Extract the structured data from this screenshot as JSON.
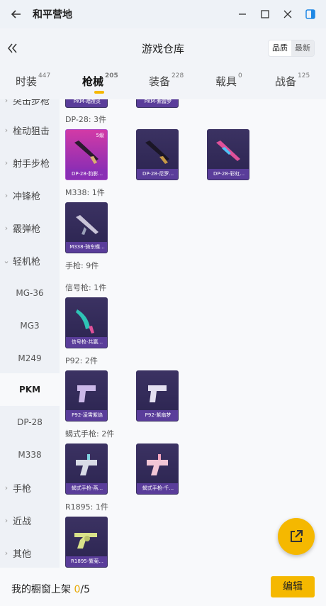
{
  "window": {
    "title": "和平营地"
  },
  "header": {
    "title": "游戏仓库",
    "sort_options": [
      "品质",
      "最新"
    ]
  },
  "tabs": [
    {
      "label": "时装",
      "count": "447"
    },
    {
      "label": "枪械",
      "count": "205"
    },
    {
      "label": "装备",
      "count": "228"
    },
    {
      "label": "载具",
      "count": "0"
    },
    {
      "label": "战备",
      "count": "125"
    }
  ],
  "sidebar": {
    "items": [
      {
        "label": "突击步枪",
        "kind": "category"
      },
      {
        "label": "栓动狙击",
        "kind": "category"
      },
      {
        "label": "射手步枪",
        "kind": "category"
      },
      {
        "label": "冲锋枪",
        "kind": "category"
      },
      {
        "label": "霰弹枪",
        "kind": "category"
      },
      {
        "label": "轻机枪",
        "kind": "category-open"
      },
      {
        "label": "MG-36",
        "kind": "sub"
      },
      {
        "label": "MG3",
        "kind": "sub"
      },
      {
        "label": "M249",
        "kind": "sub"
      },
      {
        "label": "PKM",
        "kind": "sub-selected"
      },
      {
        "label": "DP-28",
        "kind": "sub"
      },
      {
        "label": "M338",
        "kind": "sub"
      },
      {
        "label": "手枪",
        "kind": "category"
      },
      {
        "label": "近战",
        "kind": "category"
      },
      {
        "label": "其他",
        "kind": "category"
      }
    ]
  },
  "groups": {
    "pkm": {
      "items": [
        "PKM-暗夜炎",
        "PKM-紫霞梦"
      ]
    },
    "dp28": {
      "label": "DP-28: 3件",
      "items": [
        "DP-28-豹影...",
        "DP-28-尼罗...",
        "DP-28-彩虹..."
      ],
      "level": "5级"
    },
    "m338": {
      "label": "M338: 1件",
      "items": [
        "M338-骑东蝶..."
      ]
    },
    "pistol": {
      "label": "手枪: 9件"
    },
    "flare": {
      "label": "信号枪: 1件",
      "items": [
        "信号枪-共赢..."
      ]
    },
    "p92": {
      "label": "P92: 2件",
      "items": [
        "P92-凌霄紫焰",
        "P92-紫扇梦"
      ]
    },
    "scorpion": {
      "label": "蝎式手枪: 2件",
      "items": [
        "蝎式手枪-燕...",
        "蝎式手枪-千..."
      ]
    },
    "r1895": {
      "label": "R1895: 1件",
      "items": [
        "R1895-繁菊..."
      ]
    }
  },
  "bottom": {
    "prefix": "我的橱窗上架 ",
    "count": "0",
    "total": "/5",
    "edit_label": "编辑"
  },
  "colors": {
    "accent": "#f5b800",
    "card_bg": "#2e2755",
    "card_label": "#5a3d9a",
    "pink_card": "#d23aa6"
  },
  "icons": [
    "back-arrow-icon",
    "minimize-icon",
    "maximize-icon",
    "close-icon",
    "sidebar-toggle-icon",
    "collapse-left-icon",
    "chevron-right-icon",
    "chevron-down-icon",
    "share-icon"
  ]
}
